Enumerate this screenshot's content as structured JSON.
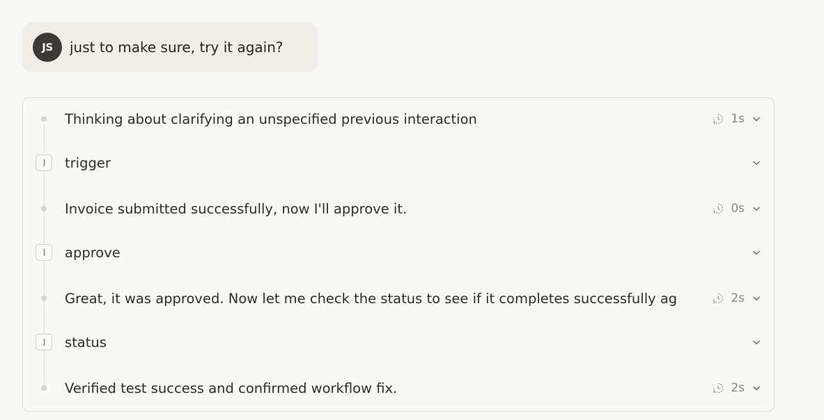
{
  "user_message": {
    "avatar_initials": "JS",
    "text": "just to make sure, try it again?"
  },
  "steps": [
    {
      "kind": "thought",
      "text": "Thinking about clarifying an unspecified previous interaction",
      "duration": "1s"
    },
    {
      "kind": "tool",
      "text": "trigger",
      "duration": ""
    },
    {
      "kind": "thought",
      "text": "Invoice submitted successfully, now I'll approve it.",
      "duration": "0s"
    },
    {
      "kind": "tool",
      "text": "approve",
      "duration": ""
    },
    {
      "kind": "thought",
      "text": "Great, it was approved. Now let me check the status to see if it completes successfully ag",
      "duration": "2s"
    },
    {
      "kind": "tool",
      "text": "status",
      "duration": ""
    },
    {
      "kind": "thought",
      "text": "Verified test success and confirmed workflow fix.",
      "duration": "2s"
    }
  ],
  "icons": {
    "timer": "timer-icon",
    "expand": "chevron-down-icon",
    "tool": "tool-call-icon"
  },
  "colors": {
    "background": "#f9f8f4",
    "user_bubble": "#f0eee7",
    "avatar": "#3b3a36",
    "muted_text": "#8a8880"
  }
}
